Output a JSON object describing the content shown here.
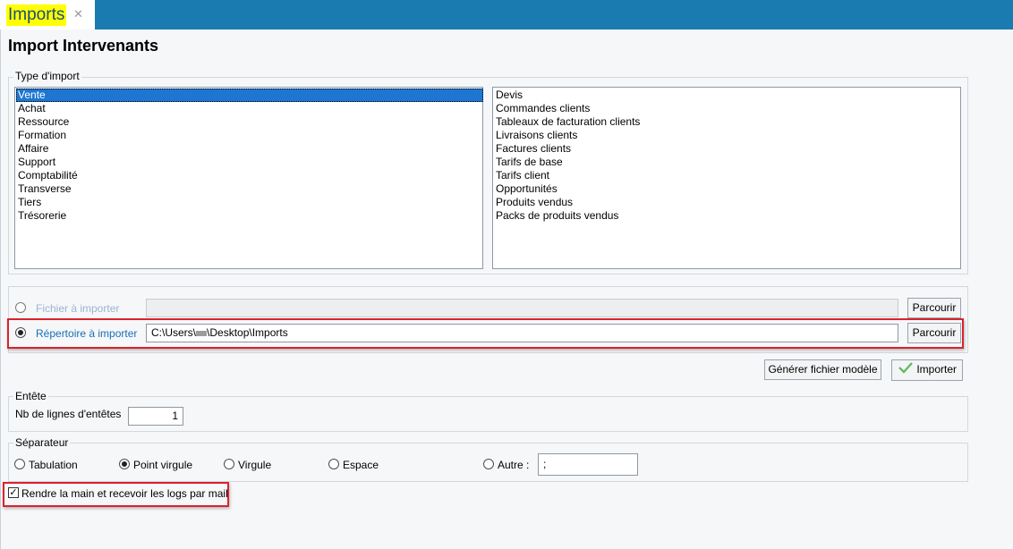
{
  "tab": {
    "label": "Imports",
    "close": "✕"
  },
  "page_title": "Import Intervenants",
  "type_import": {
    "legend": "Type d'import",
    "categories": [
      "Vente",
      "Achat",
      "Ressource",
      "Formation",
      "Affaire",
      "Support",
      "Comptabilité",
      "Transverse",
      "Tiers",
      "Trésorerie"
    ],
    "selected": "Vente",
    "items": [
      "Devis",
      "Commandes clients",
      "Tableaux de facturation clients",
      "Livraisons clients",
      "Factures clients",
      "Tarifs de base",
      "Tarifs client",
      "Opportunités",
      "Produits vendus",
      "Packs de produits vendus"
    ]
  },
  "source": {
    "file_label": "Fichier à importer",
    "file_value": "",
    "file_selected": false,
    "dir_label": "Répertoire à importer",
    "dir_value_prefix": "C:\\Users\\",
    "dir_value_suffix": "\\Desktop\\Imports",
    "dir_selected": true,
    "browse_label": "Parcourir"
  },
  "actions": {
    "generate_label": "Générer fichier modèle",
    "import_label": "Importer"
  },
  "entete": {
    "legend": "Entête",
    "lines_label": "Nb de lignes d'entêtes",
    "lines_value": "1"
  },
  "separateur": {
    "legend": "Séparateur",
    "options": [
      "Tabulation",
      "Point virgule",
      "Virgule",
      "Espace",
      "Autre :"
    ],
    "selected": "Point virgule",
    "other_value": ";"
  },
  "mail_option": {
    "label": "Rendre la main et recevoir les logs par mail",
    "checked": true
  }
}
